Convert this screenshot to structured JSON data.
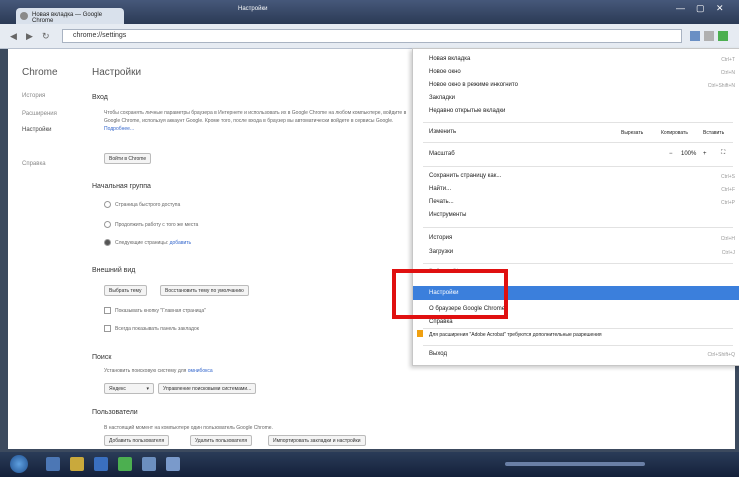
{
  "window": {
    "tab_title": "Новая вкладка — Google Chrome",
    "title": "Настройки",
    "controls": [
      "—",
      "▢",
      "✕"
    ]
  },
  "toolbar": {
    "back_icon": "back-arrow-icon",
    "forward_icon": "forward-arrow-icon",
    "reload_icon": "reload-icon",
    "address": "chrome://settings"
  },
  "sidebar": {
    "brand": "Chrome",
    "items": [
      {
        "label": "История"
      },
      {
        "label": "Расширения"
      },
      {
        "label": "Настройки"
      },
      {
        "label": "Справка"
      }
    ]
  },
  "settings": {
    "title": "Настройки",
    "login": {
      "heading": "Вход",
      "text": "Чтобы сохранять личные параметры браузера в Интернете и использовать их в Google Chrome на любом компьютере, войдите в Google Chrome, используя аккаунт Google. Кроме того, после входа в браузер вы автоматически войдете в сервисы Google.",
      "link": "Подробнее...",
      "button": "Войти в Chrome"
    },
    "startup": {
      "heading": "Начальная группа",
      "options": [
        {
          "label": "Страница быстрого доступа",
          "selected": false
        },
        {
          "label": "Продолжить работу с того же места",
          "selected": false
        },
        {
          "label": "Следующие страницы:",
          "link": "добавить",
          "selected": true
        }
      ]
    },
    "appearance": {
      "heading": "Внешний вид",
      "buttons": [
        "Выбрать тему",
        "Восстановить тему по умолчанию"
      ],
      "checks": [
        "Показывать кнопку \"Главная страница\"",
        "Всегда показывать панель закладок"
      ]
    },
    "search": {
      "heading": "Поиск",
      "text": "Установить поисковую систему для",
      "link": "омнибокса",
      "engine": "Яндекс",
      "manage": "Управление поисковыми системами..."
    },
    "users": {
      "heading": "Пользователи",
      "text": "В настоящий момент на компьютере один пользователь Google Chrome.",
      "buttons": [
        "Добавить пользователя",
        "Удалить пользователя",
        "Импортировать закладки и настройки"
      ]
    }
  },
  "menu": {
    "items_top": [
      {
        "label": "Новая вкладка",
        "shortcut": "Ctrl+T"
      },
      {
        "label": "Новое окно",
        "shortcut": "Ctrl+N"
      },
      {
        "label": "Новое окно в режиме инкогнито",
        "shortcut": "Ctrl+Shift+N"
      },
      {
        "label": "Закладки",
        "shortcut": ""
      },
      {
        "label": "Недавно открытые вкладки",
        "shortcut": ""
      }
    ],
    "edit": {
      "label": "Изменить",
      "cut": "Вырезать",
      "copy": "Копировать",
      "paste": "Вставить"
    },
    "zoom": {
      "label": "Масштаб",
      "minus": "−",
      "value": "100%",
      "plus": "+",
      "fullscreen_icon": "fullscreen-icon"
    },
    "items_mid": [
      {
        "label": "Сохранить страницу как...",
        "shortcut": "Ctrl+S"
      },
      {
        "label": "Найти...",
        "shortcut": "Ctrl+F"
      },
      {
        "label": "Печать...",
        "shortcut": "Ctrl+P"
      },
      {
        "label": "Инструменты",
        "shortcut": ""
      }
    ],
    "items_hist": [
      {
        "label": "История",
        "shortcut": "Ctrl+H"
      },
      {
        "label": "Загрузки",
        "shortcut": "Ctrl+J"
      }
    ],
    "signin": "Войти в Chrome...",
    "settings": "Настройки",
    "about": "О браузере Google Chrome",
    "help": "Справка",
    "warning": "Для расширения \"Adobe Acrobat\" требуются дополнительные разрешения",
    "exit": {
      "label": "Выход",
      "shortcut": "Ctrl+Shift+Q"
    }
  },
  "colors": {
    "highlight": "#3b7fdc",
    "annotation": "#e01010"
  },
  "taskbar": {
    "start_icon": "windows-start-icon"
  }
}
